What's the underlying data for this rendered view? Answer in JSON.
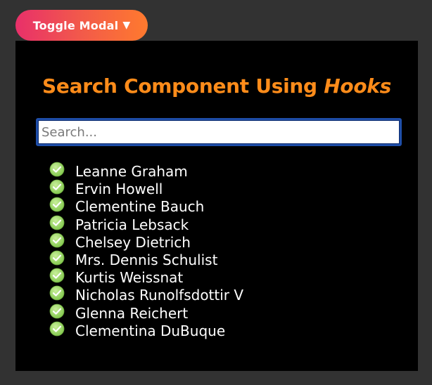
{
  "toggle_button": {
    "label": "Toggle Modal",
    "caret": "▼",
    "gradient": [
      "#e8306a",
      "#ff7a2e"
    ]
  },
  "modal": {
    "title_main": "Search Component Using ",
    "title_emphasis": "Hooks",
    "title_color": "#ff8c1a",
    "search": {
      "placeholder": "Search...",
      "value": ""
    },
    "items": [
      {
        "name": "Leanne Graham",
        "icon": "check-circle-icon"
      },
      {
        "name": "Ervin Howell",
        "icon": "check-circle-icon"
      },
      {
        "name": "Clementine Bauch",
        "icon": "check-circle-icon"
      },
      {
        "name": "Patricia Lebsack",
        "icon": "check-circle-icon"
      },
      {
        "name": "Chelsey Dietrich",
        "icon": "check-circle-icon"
      },
      {
        "name": "Mrs. Dennis Schulist",
        "icon": "check-circle-icon"
      },
      {
        "name": "Kurtis Weissnat",
        "icon": "check-circle-icon"
      },
      {
        "name": "Nicholas Runolfsdottir V",
        "icon": "check-circle-icon"
      },
      {
        "name": "Glenna Reichert",
        "icon": "check-circle-icon"
      },
      {
        "name": "Clementina DuBuque",
        "icon": "check-circle-icon"
      }
    ]
  }
}
